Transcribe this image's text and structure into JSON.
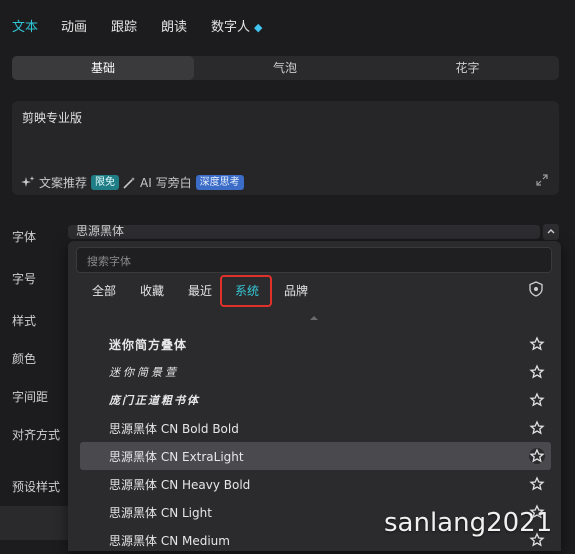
{
  "top_tabs": [
    {
      "label": "文本",
      "active": true
    },
    {
      "label": "动画"
    },
    {
      "label": "跟踪"
    },
    {
      "label": "朗读"
    },
    {
      "label": "数字人"
    }
  ],
  "segment_tabs": [
    {
      "label": "基础",
      "active": true
    },
    {
      "label": "气泡"
    },
    {
      "label": "花字"
    }
  ],
  "text_input": {
    "value": "剪映专业版",
    "tool_recommend": "文案推荐",
    "badge_free": "限免",
    "tool_ai": "AI 写旁白",
    "badge_deep": "深度思考"
  },
  "labels": {
    "font": "字体",
    "size": "字号",
    "style": "样式",
    "color": "颜色",
    "spacing": "字间距",
    "align": "对齐方式",
    "preset": "预设样式"
  },
  "font_select": {
    "value": "思源黑体"
  },
  "dropdown": {
    "search_placeholder": "搜索字体",
    "categories": [
      {
        "label": "全部"
      },
      {
        "label": "收藏"
      },
      {
        "label": "最近"
      },
      {
        "label": "系统",
        "active": true
      },
      {
        "label": "品牌"
      }
    ],
    "fonts": [
      {
        "name": "迷你简方叠体"
      },
      {
        "name": "迷你简景萱"
      },
      {
        "name": "庞门正道粗书体"
      },
      {
        "name": "思源黑体 CN Bold Bold"
      },
      {
        "name": "思源黑体 CN ExtraLight",
        "highlighted": true
      },
      {
        "name": "思源黑体 CN Heavy Bold"
      },
      {
        "name": "思源黑体 CN Light"
      },
      {
        "name": "思源黑体 CN Medium"
      }
    ]
  },
  "watermark": "sanlang2021",
  "colors": {
    "accent": "#2fc6d6",
    "highlight_box": "#e0302a"
  }
}
